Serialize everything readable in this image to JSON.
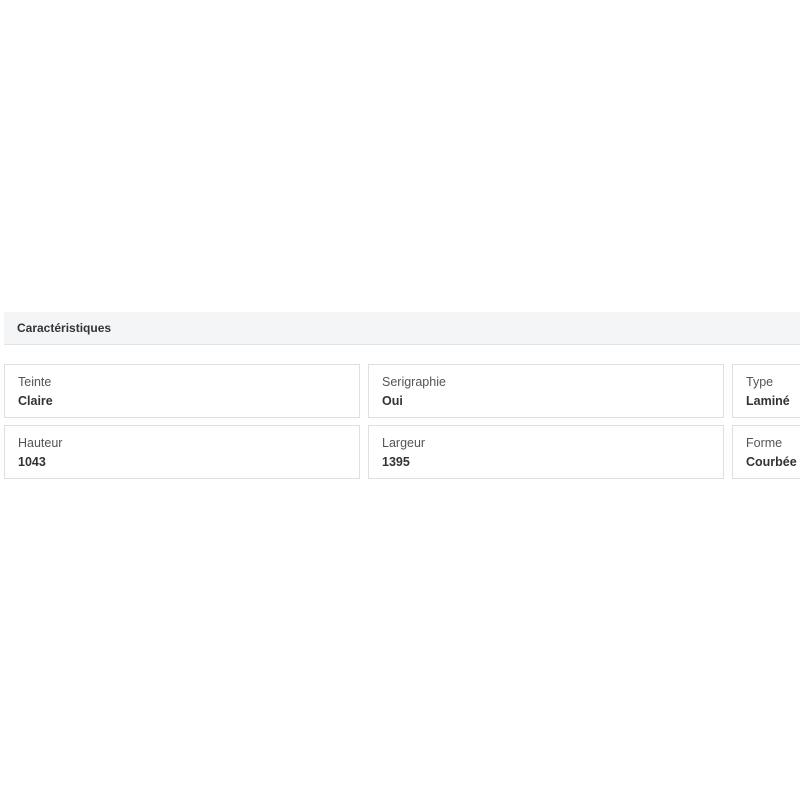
{
  "section": {
    "title": "Caractéristiques"
  },
  "characteristics": [
    [
      {
        "label": "Teinte",
        "value": "Claire"
      },
      {
        "label": "Serigraphie",
        "value": "Oui"
      },
      {
        "label": "Type",
        "value": "Laminé"
      }
    ],
    [
      {
        "label": "Hauteur",
        "value": "1043"
      },
      {
        "label": "Largeur",
        "value": "1395"
      },
      {
        "label": "Forme",
        "value": "Courbée"
      }
    ]
  ]
}
